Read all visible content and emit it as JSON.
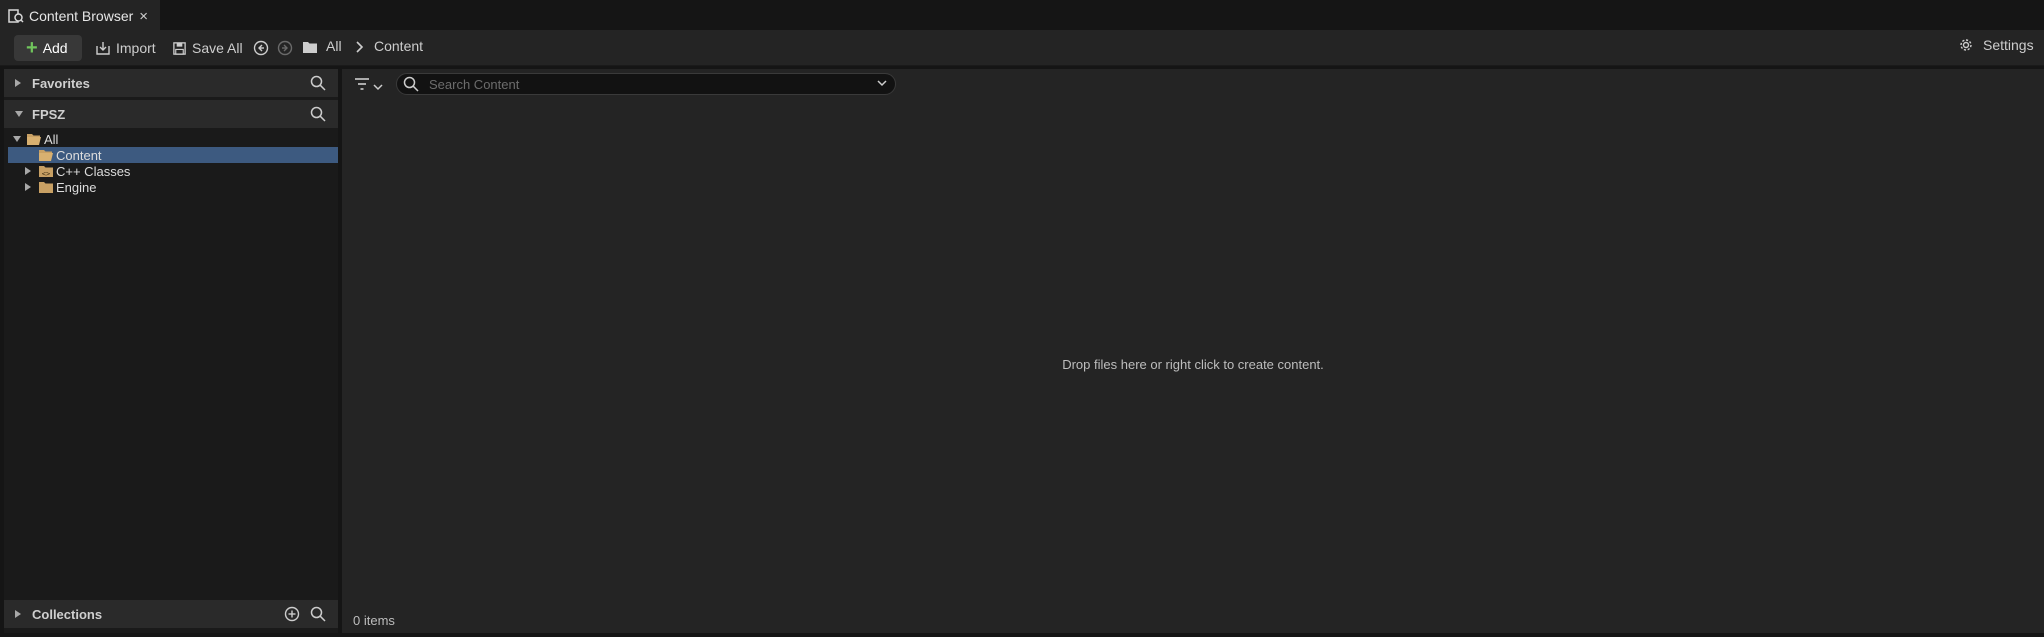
{
  "tab": {
    "title": "Content Browser",
    "icon": "content-browser-icon",
    "close_label": "×"
  },
  "toolbar": {
    "add_label": "Add",
    "import_label": "Import",
    "save_all_label": "Save All",
    "breadcrumb": [
      "All",
      "Content"
    ],
    "settings_label": "Settings"
  },
  "sources": {
    "favorites_label": "Favorites",
    "project_label": "FPSZ",
    "collections_label": "Collections",
    "tree": [
      {
        "label": "All",
        "expanded": true,
        "selected": false,
        "level": 0
      },
      {
        "label": "Content",
        "expanded": false,
        "selected": true,
        "level": 1
      },
      {
        "label": "C++ Classes",
        "expanded": false,
        "selected": false,
        "level": 1
      },
      {
        "label": "Engine",
        "expanded": false,
        "selected": false,
        "level": 1
      }
    ]
  },
  "main": {
    "search_placeholder": "Search Content",
    "empty_message": "Drop files here or right click to create content.",
    "item_count": "0 items"
  },
  "colors": {
    "accent_selected": "#3d5a80",
    "add_plus": "#70c45c",
    "folder": "#c8a064"
  }
}
